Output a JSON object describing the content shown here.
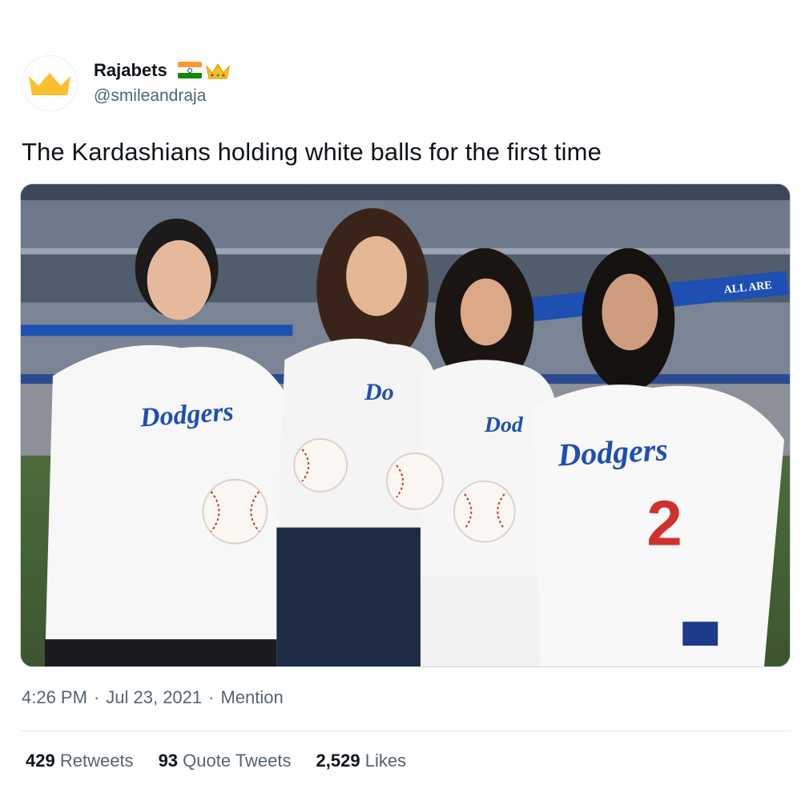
{
  "author": {
    "display_name": "Rajabets",
    "handle": "@smileandraja",
    "avatar_icon": "crown-icon",
    "name_emojis": [
      "india-flag-icon",
      "crown-icon"
    ],
    "accent_color": "#fbc02d"
  },
  "tweet": {
    "text": "The Kardashians holding white balls for the first time",
    "media_alt": "Dodgers"
  },
  "meta": {
    "time": "4:26 PM",
    "separator": "·",
    "date": "Jul 23, 2021",
    "source": "Mention"
  },
  "stats": {
    "retweets": {
      "count": "429",
      "label": "Retweets"
    },
    "quote_tweets": {
      "count": "93",
      "label": "Quote Tweets"
    },
    "likes": {
      "count": "2,529",
      "label": "Likes"
    }
  },
  "photo": {
    "jersey_text": "Dodgers",
    "jersey_number": "2",
    "banner_text": "ALL ARE",
    "brand_color": "#1e4fb3",
    "number_color": "#d0312d"
  }
}
